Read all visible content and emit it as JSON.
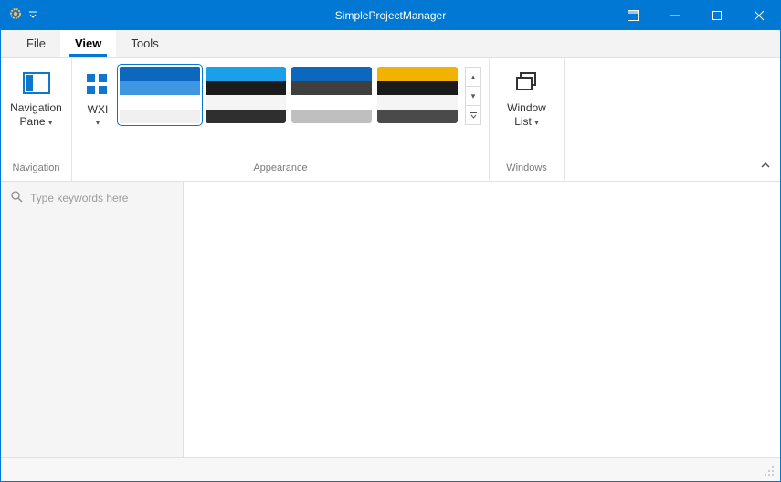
{
  "title": "SimpleProjectManager",
  "tabs": {
    "file": "File",
    "view": "View",
    "tools": "Tools"
  },
  "ribbon": {
    "navigation": {
      "group_label": "Navigation",
      "nav_pane_line1": "Navigation",
      "nav_pane_line2": "Pane"
    },
    "appearance": {
      "group_label": "Appearance",
      "wxi_label": "WXI",
      "themes": [
        {
          "name": "theme-blue-light",
          "selected": true,
          "colors": [
            "#0c67bf",
            "#3e97e0",
            "#ffffff",
            "#f0f0f0"
          ]
        },
        {
          "name": "theme-blue-dark",
          "selected": false,
          "colors": [
            "#1aa0e8",
            "#1b1b1b",
            "#f5f5f5",
            "#2f2f2f"
          ]
        },
        {
          "name": "theme-blue-gray",
          "selected": false,
          "colors": [
            "#0c67bf",
            "#3f3f3f",
            "#ffffff",
            "#bfbfbf"
          ]
        },
        {
          "name": "theme-amber",
          "selected": false,
          "colors": [
            "#f2b200",
            "#1b1b1b",
            "#f5f5f5",
            "#4a4a4a"
          ]
        }
      ]
    },
    "windows": {
      "group_label": "Windows",
      "window_list_line1": "Window",
      "window_list_line2": "List"
    }
  },
  "search": {
    "placeholder": "Type keywords here"
  }
}
